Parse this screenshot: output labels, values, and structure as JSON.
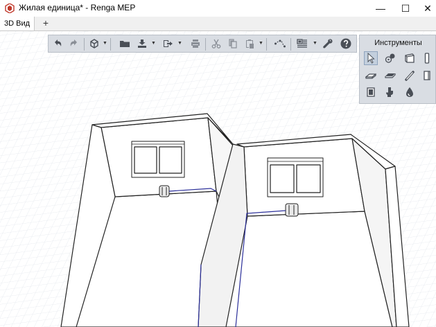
{
  "window": {
    "title": "Жилая единица* - Renga MEP",
    "minimize": "—",
    "maximize": "☐",
    "close": "✕"
  },
  "tabs": [
    {
      "label": "3D Вид",
      "active": true
    }
  ],
  "tab_add": "+",
  "toolbar": {
    "buttons": [
      {
        "icon": "undo-icon"
      },
      {
        "icon": "redo-icon"
      },
      {
        "icon": "view-cube-icon"
      },
      {
        "icon": "folder-icon"
      },
      {
        "icon": "export-icon"
      },
      {
        "icon": "import-icon"
      },
      {
        "icon": "print-icon"
      },
      {
        "icon": "cut-icon"
      },
      {
        "icon": "copy-icon"
      },
      {
        "icon": "paste-icon"
      },
      {
        "icon": "connect-route-icon"
      },
      {
        "icon": "layers-icon"
      },
      {
        "icon": "wrench-icon"
      },
      {
        "icon": "help-icon"
      }
    ]
  },
  "tools_panel": {
    "title": "Инструменты",
    "tools": [
      {
        "icon": "select-cursor-icon",
        "active": true
      },
      {
        "icon": "equipment-icon"
      },
      {
        "icon": "wall-icon"
      },
      {
        "icon": "column-icon"
      },
      {
        "icon": "floor-slab-icon"
      },
      {
        "icon": "beam-icon"
      },
      {
        "icon": "pipe-icon"
      },
      {
        "icon": "panel-icon"
      },
      {
        "icon": "door-icon"
      },
      {
        "icon": "sanitary-icon"
      },
      {
        "icon": "drop-icon"
      }
    ]
  },
  "colors": {
    "toolbar_bg": "#d9dde3",
    "icon_gray": "#4a4f57",
    "grid": "#dfe4ea",
    "pipe": "#2b2f9a",
    "accent_red": "#c0392b"
  }
}
